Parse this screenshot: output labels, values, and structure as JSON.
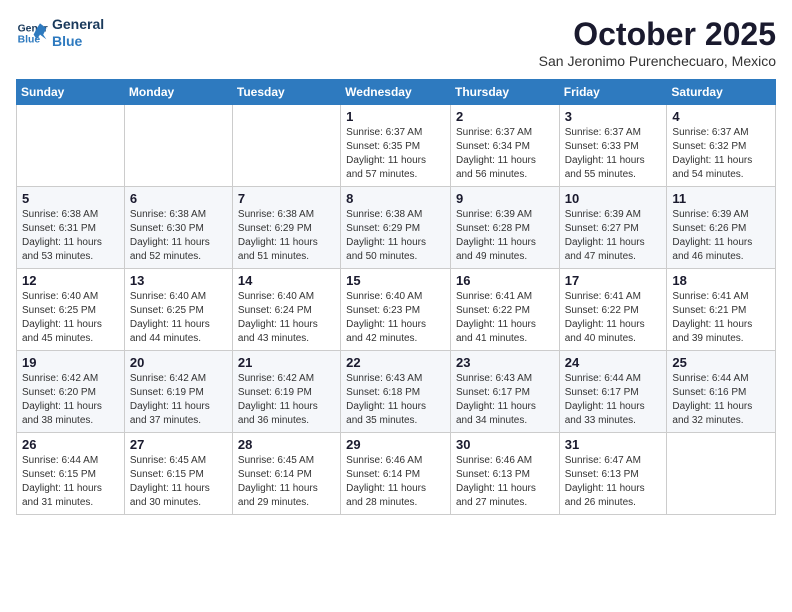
{
  "header": {
    "logo_line1": "General",
    "logo_line2": "Blue",
    "month": "October 2025",
    "location": "San Jeronimo Purenchecuaro, Mexico"
  },
  "weekdays": [
    "Sunday",
    "Monday",
    "Tuesday",
    "Wednesday",
    "Thursday",
    "Friday",
    "Saturday"
  ],
  "weeks": [
    [
      {
        "day": "",
        "info": ""
      },
      {
        "day": "",
        "info": ""
      },
      {
        "day": "",
        "info": ""
      },
      {
        "day": "1",
        "info": "Sunrise: 6:37 AM\nSunset: 6:35 PM\nDaylight: 11 hours and 57 minutes."
      },
      {
        "day": "2",
        "info": "Sunrise: 6:37 AM\nSunset: 6:34 PM\nDaylight: 11 hours and 56 minutes."
      },
      {
        "day": "3",
        "info": "Sunrise: 6:37 AM\nSunset: 6:33 PM\nDaylight: 11 hours and 55 minutes."
      },
      {
        "day": "4",
        "info": "Sunrise: 6:37 AM\nSunset: 6:32 PM\nDaylight: 11 hours and 54 minutes."
      }
    ],
    [
      {
        "day": "5",
        "info": "Sunrise: 6:38 AM\nSunset: 6:31 PM\nDaylight: 11 hours and 53 minutes."
      },
      {
        "day": "6",
        "info": "Sunrise: 6:38 AM\nSunset: 6:30 PM\nDaylight: 11 hours and 52 minutes."
      },
      {
        "day": "7",
        "info": "Sunrise: 6:38 AM\nSunset: 6:29 PM\nDaylight: 11 hours and 51 minutes."
      },
      {
        "day": "8",
        "info": "Sunrise: 6:38 AM\nSunset: 6:29 PM\nDaylight: 11 hours and 50 minutes."
      },
      {
        "day": "9",
        "info": "Sunrise: 6:39 AM\nSunset: 6:28 PM\nDaylight: 11 hours and 49 minutes."
      },
      {
        "day": "10",
        "info": "Sunrise: 6:39 AM\nSunset: 6:27 PM\nDaylight: 11 hours and 47 minutes."
      },
      {
        "day": "11",
        "info": "Sunrise: 6:39 AM\nSunset: 6:26 PM\nDaylight: 11 hours and 46 minutes."
      }
    ],
    [
      {
        "day": "12",
        "info": "Sunrise: 6:40 AM\nSunset: 6:25 PM\nDaylight: 11 hours and 45 minutes."
      },
      {
        "day": "13",
        "info": "Sunrise: 6:40 AM\nSunset: 6:25 PM\nDaylight: 11 hours and 44 minutes."
      },
      {
        "day": "14",
        "info": "Sunrise: 6:40 AM\nSunset: 6:24 PM\nDaylight: 11 hours and 43 minutes."
      },
      {
        "day": "15",
        "info": "Sunrise: 6:40 AM\nSunset: 6:23 PM\nDaylight: 11 hours and 42 minutes."
      },
      {
        "day": "16",
        "info": "Sunrise: 6:41 AM\nSunset: 6:22 PM\nDaylight: 11 hours and 41 minutes."
      },
      {
        "day": "17",
        "info": "Sunrise: 6:41 AM\nSunset: 6:22 PM\nDaylight: 11 hours and 40 minutes."
      },
      {
        "day": "18",
        "info": "Sunrise: 6:41 AM\nSunset: 6:21 PM\nDaylight: 11 hours and 39 minutes."
      }
    ],
    [
      {
        "day": "19",
        "info": "Sunrise: 6:42 AM\nSunset: 6:20 PM\nDaylight: 11 hours and 38 minutes."
      },
      {
        "day": "20",
        "info": "Sunrise: 6:42 AM\nSunset: 6:19 PM\nDaylight: 11 hours and 37 minutes."
      },
      {
        "day": "21",
        "info": "Sunrise: 6:42 AM\nSunset: 6:19 PM\nDaylight: 11 hours and 36 minutes."
      },
      {
        "day": "22",
        "info": "Sunrise: 6:43 AM\nSunset: 6:18 PM\nDaylight: 11 hours and 35 minutes."
      },
      {
        "day": "23",
        "info": "Sunrise: 6:43 AM\nSunset: 6:17 PM\nDaylight: 11 hours and 34 minutes."
      },
      {
        "day": "24",
        "info": "Sunrise: 6:44 AM\nSunset: 6:17 PM\nDaylight: 11 hours and 33 minutes."
      },
      {
        "day": "25",
        "info": "Sunrise: 6:44 AM\nSunset: 6:16 PM\nDaylight: 11 hours and 32 minutes."
      }
    ],
    [
      {
        "day": "26",
        "info": "Sunrise: 6:44 AM\nSunset: 6:15 PM\nDaylight: 11 hours and 31 minutes."
      },
      {
        "day": "27",
        "info": "Sunrise: 6:45 AM\nSunset: 6:15 PM\nDaylight: 11 hours and 30 minutes."
      },
      {
        "day": "28",
        "info": "Sunrise: 6:45 AM\nSunset: 6:14 PM\nDaylight: 11 hours and 29 minutes."
      },
      {
        "day": "29",
        "info": "Sunrise: 6:46 AM\nSunset: 6:14 PM\nDaylight: 11 hours and 28 minutes."
      },
      {
        "day": "30",
        "info": "Sunrise: 6:46 AM\nSunset: 6:13 PM\nDaylight: 11 hours and 27 minutes."
      },
      {
        "day": "31",
        "info": "Sunrise: 6:47 AM\nSunset: 6:13 PM\nDaylight: 11 hours and 26 minutes."
      },
      {
        "day": "",
        "info": ""
      }
    ]
  ]
}
